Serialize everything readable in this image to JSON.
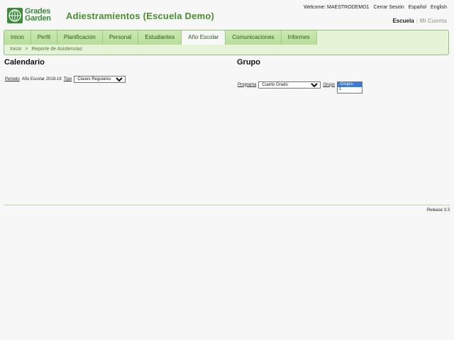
{
  "brand": {
    "logo_line1": "Grades",
    "logo_line2": "Garden",
    "logo_icon": "globe-grid-icon",
    "accent": "#4a8f2e"
  },
  "app_title": "Adiestramientos (Escuela Demo)",
  "topbar": {
    "welcome": "Welcome: MAESTRODEMO1",
    "logout": "Cerrar Sesión",
    "lang_es": "Español",
    "lang_en": "English"
  },
  "context": {
    "active": "Escuela",
    "separator": "|",
    "other": "Mi Cuenta"
  },
  "nav": {
    "tabs": [
      {
        "label": "Inicio"
      },
      {
        "label": "Perfil"
      },
      {
        "label": "Planificación"
      },
      {
        "label": "Personal"
      },
      {
        "label": "Estudiantes"
      },
      {
        "label": "Año Escolar"
      },
      {
        "label": "Comunicaciones"
      },
      {
        "label": "Informes"
      }
    ],
    "active_tab": "Año Escolar",
    "breadcrumb": {
      "home": "Inicio",
      "separator": ">",
      "current": "Reporte de Asistencias"
    }
  },
  "calendario": {
    "title": "Calendario",
    "periodo_label": "Periodo",
    "periodo_value": "Año Escolar 2018-19",
    "tipo_label": "Tipo",
    "tipo_selected": "Clases Regulares"
  },
  "grupo": {
    "title": "Grupo",
    "programa_label": "Programa",
    "programa_selected": "Cuarto Grado",
    "grupo_label": "Grupo",
    "grupo_options": [
      "-Grupo-",
      "1"
    ],
    "grupo_selected": "-Grupo-"
  },
  "footer": {
    "release": "Release 3.3"
  }
}
